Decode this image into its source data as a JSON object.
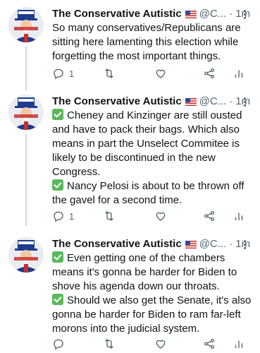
{
  "tweets": [
    {
      "name": "The Conservative Autistic",
      "handle": "@C...",
      "dot": "·",
      "time": "1m",
      "lines": [
        "So many conservatives/Republicans are sitting here lamenting this election while forgetting the most important things."
      ],
      "reply_count": "1"
    },
    {
      "name": "The Conservative Autistic",
      "handle": "@C...",
      "dot": "·",
      "time": "1m",
      "lines": [
        "Cheney and Kinzinger are still ousted and have to pack their bags. Which also means in part the Unselect Commitee is likely to be discontinued in the new Congress.",
        "Nancy Pelosi is about to be thrown off the gavel for a second time."
      ],
      "reply_count": "1"
    },
    {
      "name": "The Conservative Autistic",
      "handle": "@C...",
      "dot": "·",
      "time": "1m",
      "lines": [
        "Even getting one of the chambers means it's gonna be harder for Biden to shove his agenda down our throats.",
        "Should we also get the Senate, it's also gonna be harder for Biden to ram far-left morons into the judicial system."
      ],
      "reply_count": ""
    }
  ],
  "icons": {
    "reply": "reply-icon",
    "retweet": "retweet-icon",
    "like": "heart-icon",
    "share": "share-icon",
    "analytics": "analytics-icon",
    "more": "more-icon",
    "check": "check-mark-icon",
    "flag": "us-flag-icon"
  },
  "colors": {
    "text": "#0f1419",
    "secondary": "#536471",
    "thread_line": "#cfd9de",
    "check_green": "#5cb85c"
  }
}
